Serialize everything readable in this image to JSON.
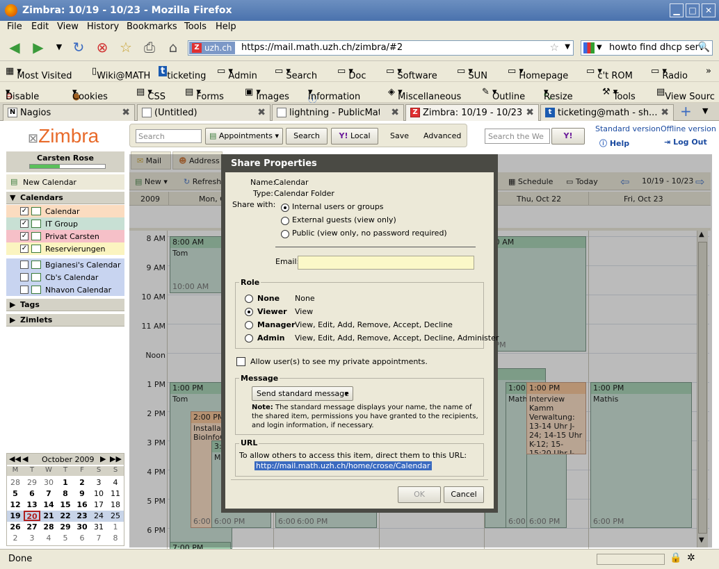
{
  "window": {
    "title": "Zimbra: 10/19 - 10/23 - Mozilla Firefox"
  },
  "menu": [
    "File",
    "Edit",
    "View",
    "History",
    "Bookmarks",
    "Tools",
    "Help"
  ],
  "address": {
    "domain": "uzh.ch",
    "url": "https://mail.math.uzh.ch/zimbra/#2",
    "search_text": "howto find dhcp serv"
  },
  "bookmarks": [
    "Most Visited",
    "Wiki@MATH",
    "ticketing",
    "Admin",
    "Search",
    "Doc",
    "Software",
    "SUN",
    "Homepage",
    "c't ROM",
    "Radio",
    "»"
  ],
  "webdev": [
    "Disable",
    "Cookies",
    "CSS",
    "Forms",
    "Images",
    "Information",
    "Miscellaneous",
    "Outline",
    "Resize",
    "Tools",
    "View Sourc"
  ],
  "tabs": [
    "Nagios",
    "(Untitled)",
    "lightning - PublicMat...",
    "Zimbra: 10/19 - 10/23",
    "ticketing@math - sh..."
  ],
  "zimbra": {
    "search_placeholder": "Search",
    "appointments_label": "Appointments",
    "search_button": "Search",
    "local_button": "Local",
    "save_button": "Save",
    "advanced_button": "Advanced",
    "web_search_placeholder": "Search the We",
    "standard_version": "Standard version",
    "offline_version": "Offline version",
    "help": "Help",
    "logout": "Log Out",
    "user_name": "Carsten Rose",
    "app_tabs": [
      "Mail",
      "Address"
    ],
    "toolbar": {
      "new": "New",
      "refresh": "Refresh",
      "schedule": "Schedule",
      "today": "Today",
      "range": "10/19 - 10/23"
    },
    "year": "2009",
    "day_headers": [
      "Mon, O",
      "Thu, Oct 22",
      "Fri, Oct 23"
    ],
    "new_calendar": "New Calendar",
    "calendars_header": "Calendars",
    "calendars": [
      {
        "name": "Calendar",
        "checked": "✓",
        "color": "#fbdcc0"
      },
      {
        "name": "IT Group",
        "checked": "✓",
        "color": "#c8e0d4"
      },
      {
        "name": "Privat Carsten",
        "checked": "✓",
        "color": "#f6c0c8"
      },
      {
        "name": "Reservierungen",
        "checked": "✓",
        "color": "#fbf4c0"
      },
      {
        "name": "Bgianesi's Calendar",
        "checked": "",
        "color": "#c8d4f0"
      },
      {
        "name": "Cb's Calendar",
        "checked": "",
        "color": "#c8d4f0"
      },
      {
        "name": "Nhavon Calendar",
        "checked": "",
        "color": "#c8d4f0"
      }
    ],
    "tags_header": "Tags",
    "zimlets_header": "Zimlets",
    "time_labels": [
      "8 AM",
      "9 AM",
      "10 AM",
      "11 AM",
      "Noon",
      "1 PM",
      "2 PM",
      "3 PM",
      "4 PM",
      "5 PM",
      "6 PM"
    ],
    "appointments": {
      "a1_head": "8:00 AM",
      "a1_body": "Tom",
      "a1_foot": "10:00 AM",
      "a2_head": "1:00 PM",
      "a2_body": "Tom",
      "a3_head": "2:00 PM",
      "a3_body": "Installatio BioInfoC",
      "a3_foot": "6:00",
      "a4_head": "3:0",
      "a4_body": "Ma",
      "a4_foot": "6:00 PM",
      "a5_foot1": "6:00",
      "a5_foot2": "6:00 PM",
      "a6_head": ":00 AM",
      "a6_body": "m",
      "a6_foot": "0 PM",
      "a7_head": "30",
      "a7_body": "el",
      "a8_head": "1:00",
      "a8_body": "Mathi",
      "a8_foot": "6:00",
      "a9_head": "1:00 PM",
      "a9_body": "Interview Kamm Verwaltung: 13-14 Uhr J-24; 14-15 Uhr K-12; 15-15:20 Uhr J-40",
      "a10_foot": "6:00 PM",
      "a11_head": "1:00 PM",
      "a11_body": "Mathis",
      "a11_foot": "6:00 PM",
      "a12_head": "7:00 PM"
    },
    "mini_cal": {
      "title": "October 2009",
      "weekdays": [
        "M",
        "T",
        "W",
        "T",
        "F",
        "S",
        "S"
      ],
      "weeks": [
        [
          "28",
          "29",
          "30",
          "1",
          "2",
          "3",
          "4"
        ],
        [
          "5",
          "6",
          "7",
          "8",
          "9",
          "10",
          "11"
        ],
        [
          "12",
          "13",
          "14",
          "15",
          "16",
          "17",
          "18"
        ],
        [
          "19",
          "20",
          "21",
          "22",
          "23",
          "24",
          "25"
        ],
        [
          "26",
          "27",
          "28",
          "29",
          "30",
          "31",
          "1"
        ],
        [
          "2",
          "3",
          "4",
          "5",
          "6",
          "7",
          "8"
        ]
      ]
    }
  },
  "dialog": {
    "title": "Share Properties",
    "name_label": "Name:",
    "name_value": "Calendar",
    "type_label": "Type:",
    "type_value": "Calendar Folder",
    "share_with_label": "Share with:",
    "share_options": [
      "Internal users or groups",
      "External guests (view only)",
      "Public (view only, no password required)"
    ],
    "email_label": "Email:",
    "role_legend": "Role",
    "roles": [
      {
        "name": "None",
        "desc": "None"
      },
      {
        "name": "Viewer",
        "desc": "View"
      },
      {
        "name": "Manager",
        "desc": "View, Edit, Add, Remove, Accept, Decline"
      },
      {
        "name": "Admin",
        "desc": "View, Edit, Add, Remove, Accept, Decline, Administer"
      }
    ],
    "private_label": "Allow user(s) to see my private appointments.",
    "message_legend": "Message",
    "message_select": "Send standard message",
    "note_bold": "Note:",
    "note_text": "The standard message displays your name, the name of the shared item, permissions you have granted to the recipients, and login information, if necessary.",
    "url_legend": "URL",
    "url_text": "To allow others to access this item, direct them to this URL:",
    "url_value": "http://mail.math.uzh.ch/home/crose/Calendar",
    "ok": "OK",
    "cancel": "Cancel"
  },
  "status": {
    "text": "Done"
  }
}
